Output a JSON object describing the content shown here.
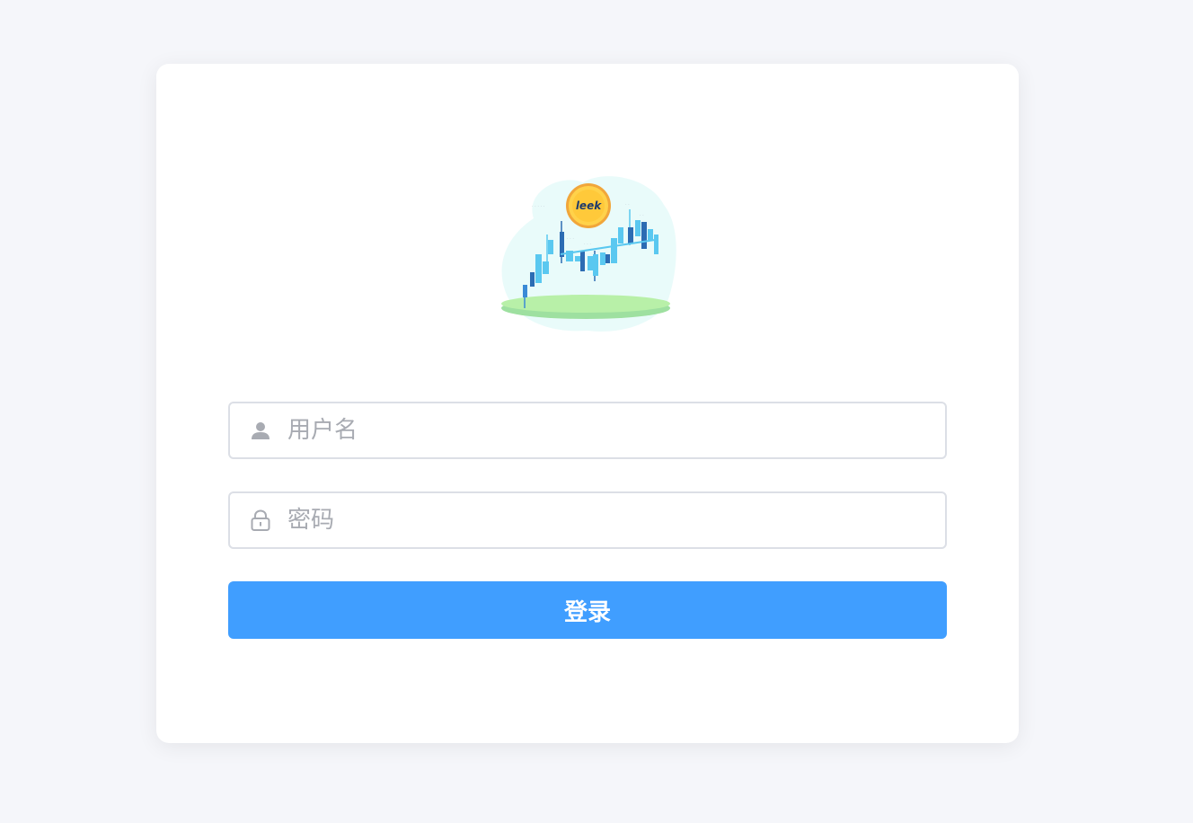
{
  "login": {
    "logo_text": "leek",
    "username": {
      "placeholder": "用户名",
      "value": "",
      "icon": "user-icon"
    },
    "password": {
      "placeholder": "密码",
      "value": "",
      "icon": "lock-icon"
    },
    "submit_label": "登录"
  },
  "colors": {
    "page_background": "#f5f6fa",
    "card_background": "#ffffff",
    "accent": "#409eff",
    "input_border": "#dcdfe6",
    "placeholder": "#a8abb2"
  }
}
